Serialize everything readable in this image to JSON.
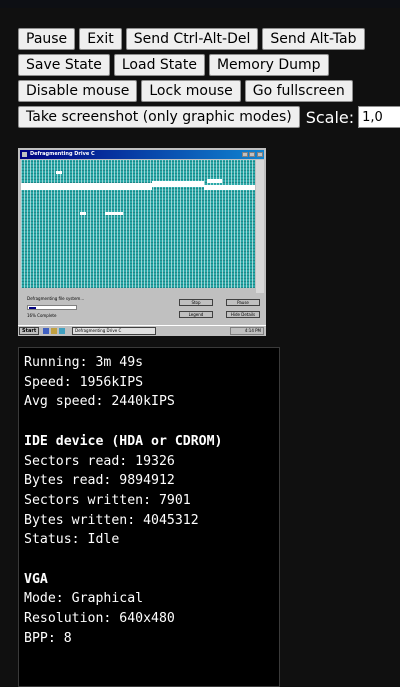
{
  "controls": {
    "pause": "Pause",
    "exit": "Exit",
    "send_ctrl_alt_del": "Send Ctrl-Alt-Del",
    "send_alt_tab": "Send Alt-Tab",
    "save_state": "Save State",
    "load_state": "Load State",
    "memory_dump": "Memory Dump",
    "disable_mouse": "Disable mouse",
    "lock_mouse": "Lock mouse",
    "go_fullscreen": "Go fullscreen",
    "take_screenshot": "Take screenshot (only graphic modes)",
    "scale_label": "Scale:",
    "scale_value": "1,0"
  },
  "screen": {
    "window_title": "Defragmenting Drive C",
    "status_text": "Defragmenting file system...",
    "percent_text": "16% Complete",
    "progress": 0.16,
    "btn_stop": "Stop",
    "btn_pause": "Pause",
    "btn_legend": "Legend",
    "btn_hide_details": "Hide Details",
    "start_label": "Start",
    "task_label": "Defragmenting Drive C",
    "clock": "4:14 PM"
  },
  "stats": {
    "running": "Running: 3m 49s",
    "speed": "Speed: 1956kIPS",
    "avg_speed": "Avg speed: 2440kIPS",
    "ide_header": "IDE device (HDA or CDROM)",
    "sectors_read": "Sectors read: 19326",
    "bytes_read": "Bytes read: 9894912",
    "sectors_written": "Sectors written: 7901",
    "bytes_written": "Bytes written: 4045312",
    "status": "Status: Idle",
    "vga_header": "VGA",
    "mode": "Mode: Graphical",
    "resolution": "Resolution: 640x480",
    "bpp": "BPP: 8"
  }
}
